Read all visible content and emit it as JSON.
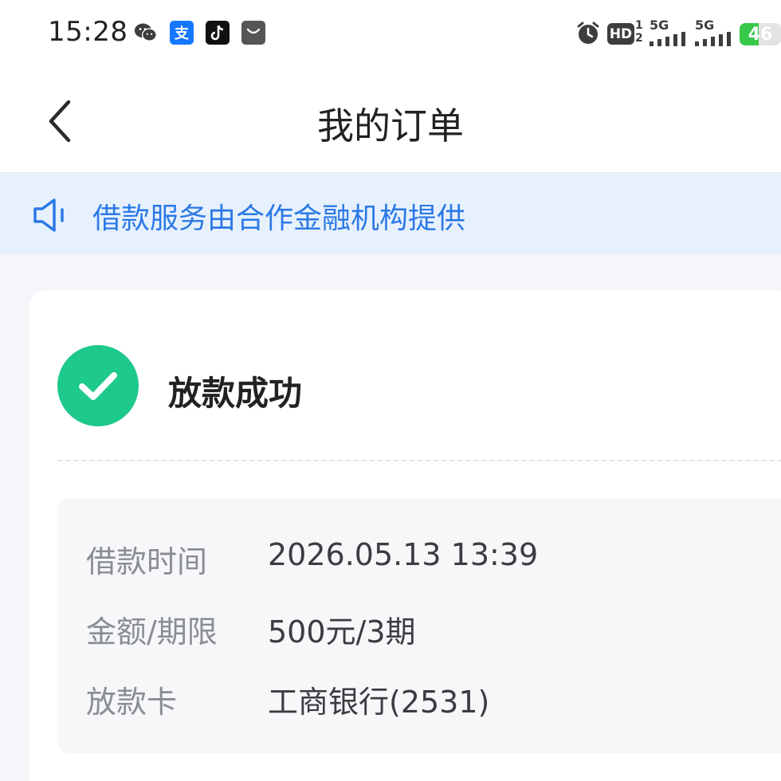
{
  "status_bar": {
    "time": "15:28",
    "apps": [
      {
        "icon": "wechat-icon"
      },
      {
        "icon": "alipay-icon",
        "glyph": "支"
      },
      {
        "icon": "tiktok-icon"
      },
      {
        "icon": "mail-icon"
      }
    ],
    "alarm_icon": "alarm-icon",
    "hd_label": "HD",
    "sim_slots": "1 2",
    "network_1": "5G",
    "network_2": "5G",
    "battery_level": "46",
    "battery_fraction": 0.46,
    "colors": {
      "battery": "#38c94a"
    }
  },
  "header": {
    "title": "我的订单",
    "back_icon": "chevron-left-icon"
  },
  "notice": {
    "icon": "speaker-icon",
    "text": "借款服务由合作金融机构提供",
    "color": "#2b79e6"
  },
  "order": {
    "status_icon": "check-circle-icon",
    "status_text": "放款成功",
    "status_color": "#1ec98c",
    "details": [
      {
        "label": "借款时间",
        "value": "2026.05.13 13:39"
      },
      {
        "label": "金额/期限",
        "value": "500元/3期"
      },
      {
        "label": "放款卡",
        "value": "工商银行(2531)"
      }
    ]
  }
}
